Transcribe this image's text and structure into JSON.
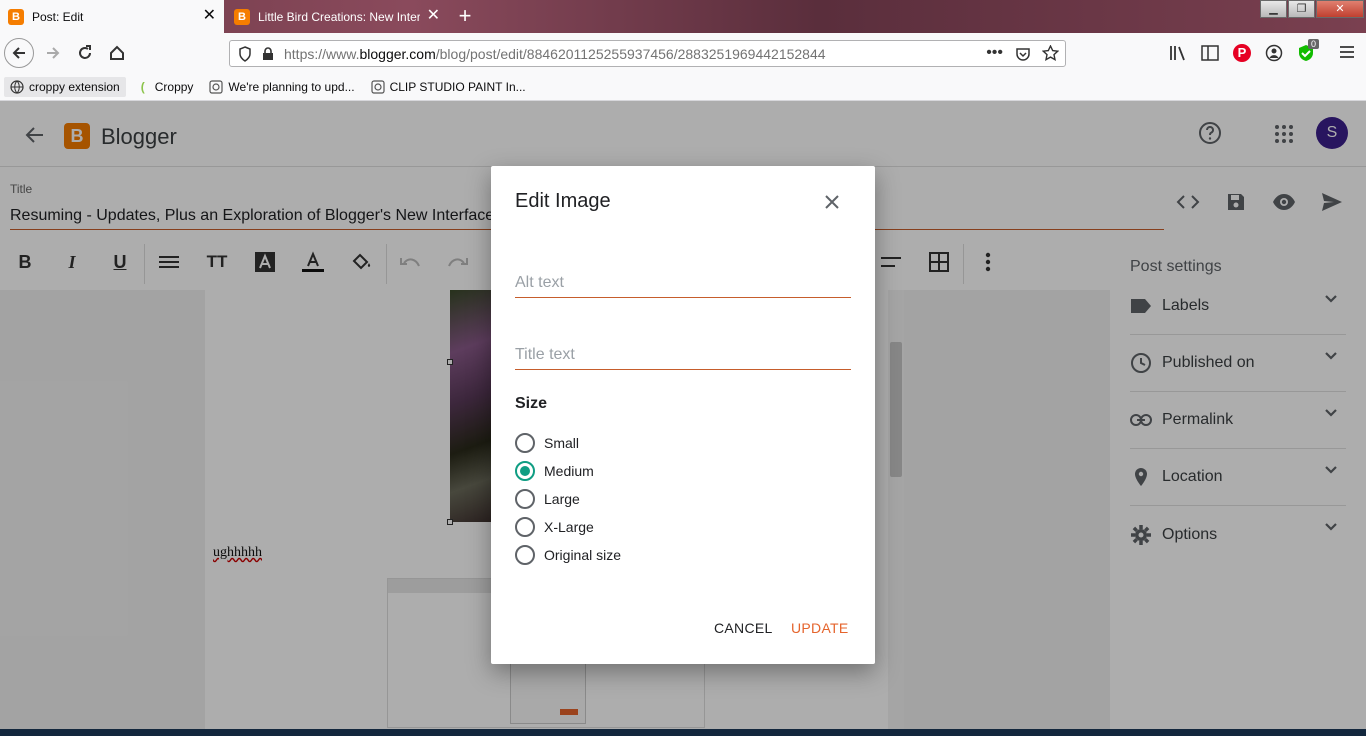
{
  "browser": {
    "tabs": [
      {
        "title": "Post: Edit",
        "icon": "blogger-icon"
      },
      {
        "title": "Little Bird Creations: New Interf",
        "icon": "blogger-icon"
      }
    ],
    "new_tab": "+",
    "url_prefix": "https://www.",
    "url_host": "blogger.com",
    "url_path": "/blog/post/edit/8846201125255937456/2883251969442152844",
    "extension_badge": "0",
    "bookmarks": [
      {
        "label": "croppy extension",
        "icon": "globe-icon"
      },
      {
        "label": "Croppy",
        "icon": "croppy-icon"
      },
      {
        "label": "We're planning to upd...",
        "icon": "clip-studio-icon"
      },
      {
        "label": "CLIP STUDIO PAINT In...",
        "icon": "clip-studio-icon"
      }
    ]
  },
  "app": {
    "brand": "Blogger",
    "avatar_letter": "S",
    "title_label": "Title",
    "post_title": "Resuming - Updates, Plus an Exploration of Blogger's New Interface",
    "body_text": "ughhhhh",
    "sidebar": {
      "heading": "Post settings",
      "items": [
        {
          "label": "Labels",
          "icon": "label-icon"
        },
        {
          "label": "Published on",
          "icon": "clock-icon"
        },
        {
          "label": "Permalink",
          "icon": "link-icon"
        },
        {
          "label": "Location",
          "icon": "location-pin-icon"
        },
        {
          "label": "Options",
          "icon": "gear-icon"
        }
      ]
    }
  },
  "dialog": {
    "title": "Edit Image",
    "alt_placeholder": "Alt text",
    "title_placeholder": "Title text",
    "size_heading": "Size",
    "sizes": [
      "Small",
      "Medium",
      "Large",
      "X-Large",
      "Original size"
    ],
    "selected_size": "Medium",
    "cancel": "CANCEL",
    "update": "UPDATE"
  },
  "colors": {
    "accent": "#c65d2c",
    "radio_selected": "#0f9d83",
    "blogger_orange": "#f57d00",
    "update_text": "#e5642c"
  }
}
